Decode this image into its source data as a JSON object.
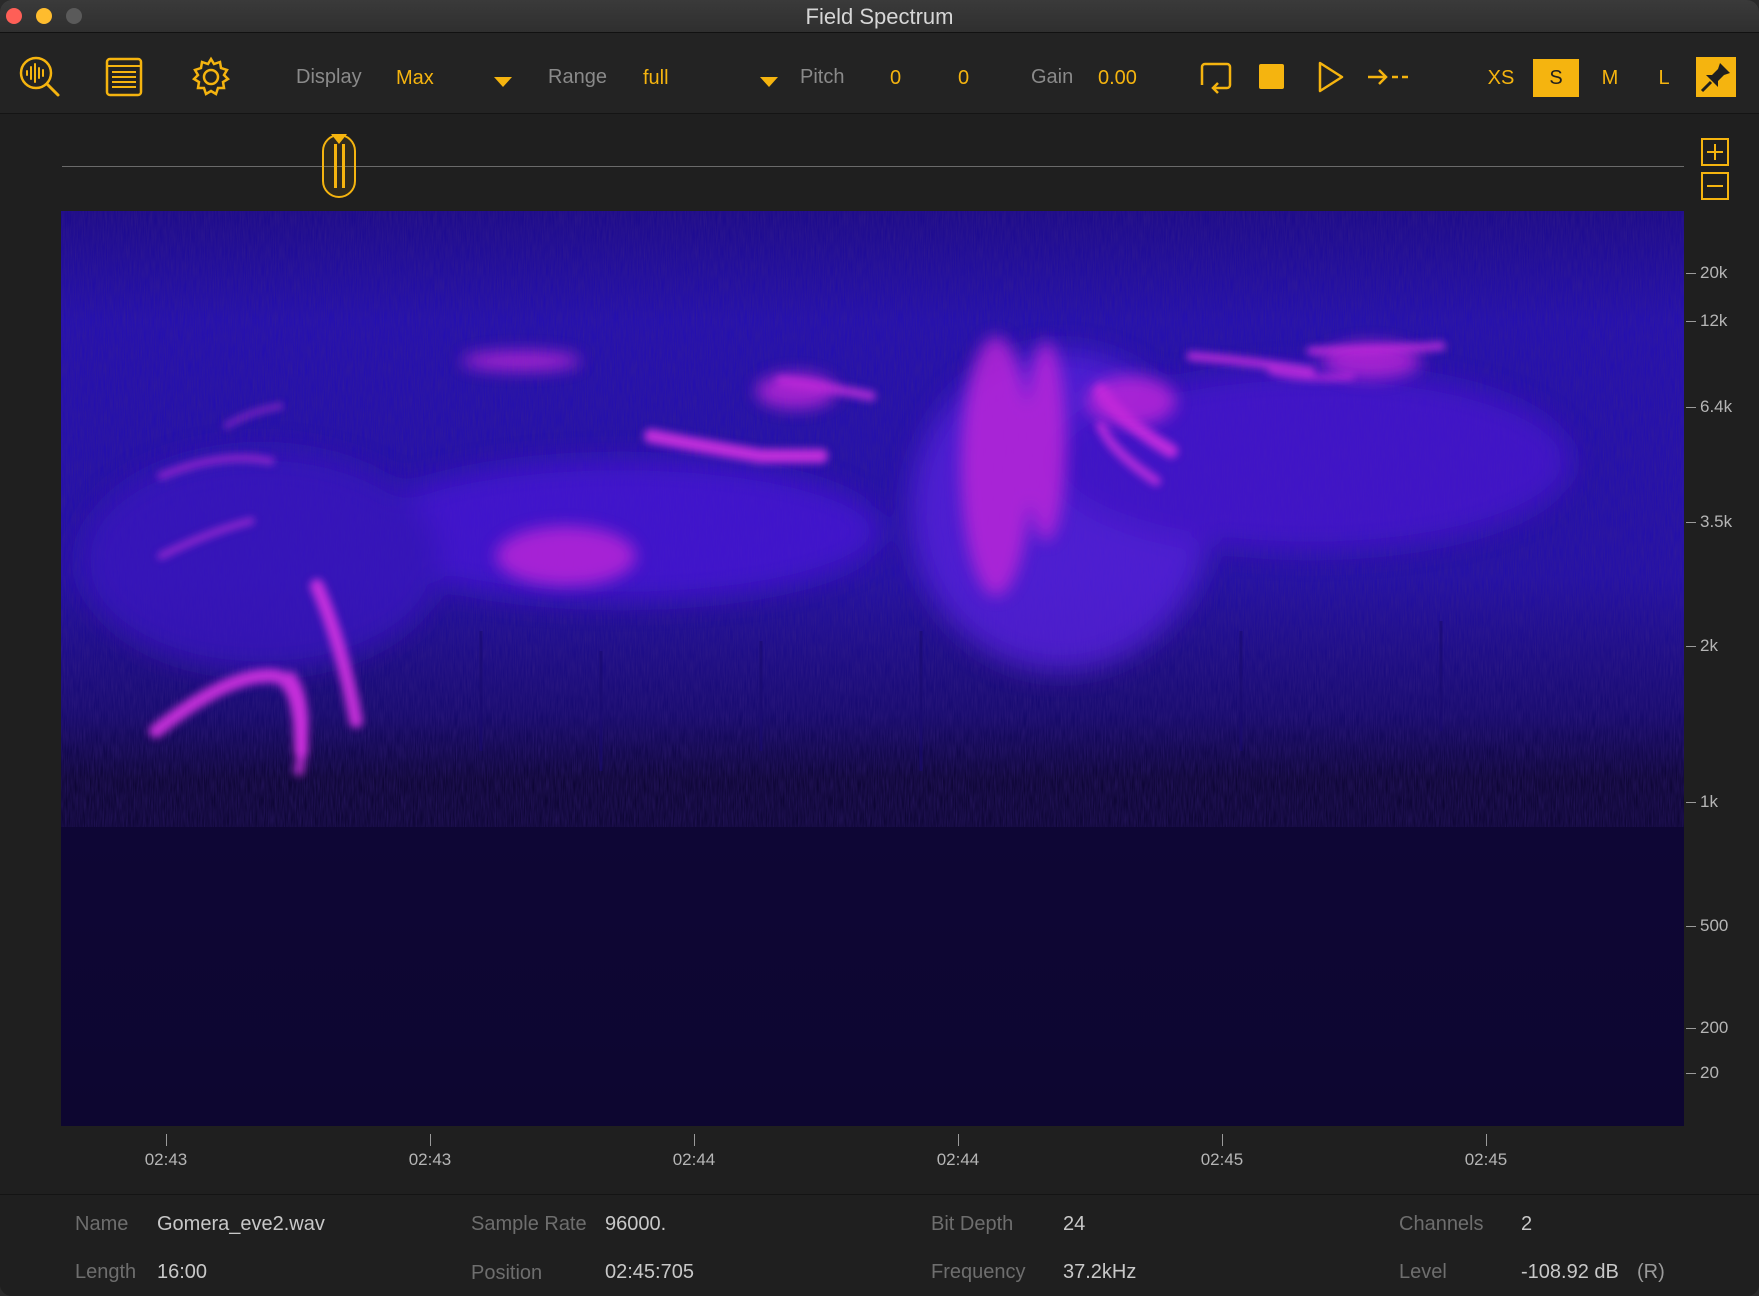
{
  "window": {
    "title": "Field Spectrum"
  },
  "toolbar": {
    "icons": [
      "spectrum-analyzer-icon",
      "list-view-icon",
      "settings-gear-icon"
    ],
    "display_label": "Display",
    "display_value": "Max",
    "range_label": "Range",
    "range_value": "full",
    "pitch_label": "Pitch",
    "pitch_value_1": "0",
    "pitch_value_2": "0",
    "gain_label": "Gain",
    "gain_value": "0.00",
    "transport_icons": [
      "loop-icon",
      "stop-icon",
      "play-icon",
      "follow-playhead-icon"
    ],
    "sizes": [
      "XS",
      "S",
      "M",
      "L"
    ],
    "active_size": "S",
    "pin_icon": "pin-icon"
  },
  "spectrogram": {
    "frequency_labels": [
      "20k",
      "12k",
      "6.4k",
      "3.5k",
      "2k",
      "1k",
      "500",
      "200",
      "20"
    ],
    "time_labels": [
      "02:43",
      "02:43",
      "02:44",
      "02:44",
      "02:45",
      "02:45"
    ]
  },
  "info": {
    "name_label": "Name",
    "name_value": "Gomera_eve2.wav",
    "length_label": "Length",
    "length_value": "16:00",
    "sample_rate_label": "Sample Rate",
    "sample_rate_value": "96000.",
    "position_label": "Position",
    "position_value": "02:45:705",
    "bit_depth_label": "Bit Depth",
    "bit_depth_value": "24",
    "frequency_label": "Frequency",
    "frequency_value": "37.2kHz",
    "channels_label": "Channels",
    "channels_value": "2",
    "level_label": "Level",
    "level_value": "-108.92 dB",
    "level_channel": "(R)"
  },
  "colors": {
    "accent": "#f5b40f",
    "spectrum_low": "#0d0630",
    "spectrum_mid": "#3a10c8",
    "spectrum_high": "#e030e8"
  }
}
